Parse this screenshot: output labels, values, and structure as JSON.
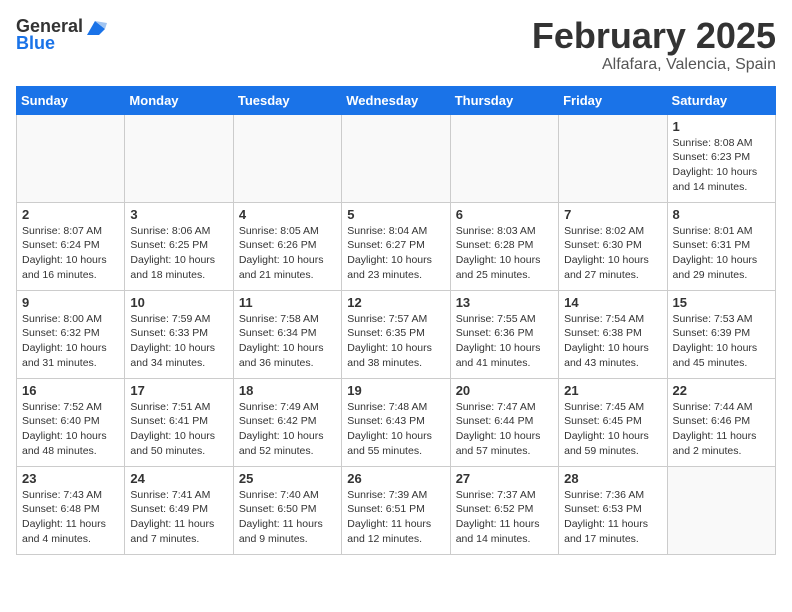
{
  "header": {
    "logo_general": "General",
    "logo_blue": "Blue",
    "month_title": "February 2025",
    "location": "Alfafara, Valencia, Spain"
  },
  "days_of_week": [
    "Sunday",
    "Monday",
    "Tuesday",
    "Wednesday",
    "Thursday",
    "Friday",
    "Saturday"
  ],
  "weeks": [
    [
      {
        "day": "",
        "info": ""
      },
      {
        "day": "",
        "info": ""
      },
      {
        "day": "",
        "info": ""
      },
      {
        "day": "",
        "info": ""
      },
      {
        "day": "",
        "info": ""
      },
      {
        "day": "",
        "info": ""
      },
      {
        "day": "1",
        "info": "Sunrise: 8:08 AM\nSunset: 6:23 PM\nDaylight: 10 hours\nand 14 minutes."
      }
    ],
    [
      {
        "day": "2",
        "info": "Sunrise: 8:07 AM\nSunset: 6:24 PM\nDaylight: 10 hours\nand 16 minutes."
      },
      {
        "day": "3",
        "info": "Sunrise: 8:06 AM\nSunset: 6:25 PM\nDaylight: 10 hours\nand 18 minutes."
      },
      {
        "day": "4",
        "info": "Sunrise: 8:05 AM\nSunset: 6:26 PM\nDaylight: 10 hours\nand 21 minutes."
      },
      {
        "day": "5",
        "info": "Sunrise: 8:04 AM\nSunset: 6:27 PM\nDaylight: 10 hours\nand 23 minutes."
      },
      {
        "day": "6",
        "info": "Sunrise: 8:03 AM\nSunset: 6:28 PM\nDaylight: 10 hours\nand 25 minutes."
      },
      {
        "day": "7",
        "info": "Sunrise: 8:02 AM\nSunset: 6:30 PM\nDaylight: 10 hours\nand 27 minutes."
      },
      {
        "day": "8",
        "info": "Sunrise: 8:01 AM\nSunset: 6:31 PM\nDaylight: 10 hours\nand 29 minutes."
      }
    ],
    [
      {
        "day": "9",
        "info": "Sunrise: 8:00 AM\nSunset: 6:32 PM\nDaylight: 10 hours\nand 31 minutes."
      },
      {
        "day": "10",
        "info": "Sunrise: 7:59 AM\nSunset: 6:33 PM\nDaylight: 10 hours\nand 34 minutes."
      },
      {
        "day": "11",
        "info": "Sunrise: 7:58 AM\nSunset: 6:34 PM\nDaylight: 10 hours\nand 36 minutes."
      },
      {
        "day": "12",
        "info": "Sunrise: 7:57 AM\nSunset: 6:35 PM\nDaylight: 10 hours\nand 38 minutes."
      },
      {
        "day": "13",
        "info": "Sunrise: 7:55 AM\nSunset: 6:36 PM\nDaylight: 10 hours\nand 41 minutes."
      },
      {
        "day": "14",
        "info": "Sunrise: 7:54 AM\nSunset: 6:38 PM\nDaylight: 10 hours\nand 43 minutes."
      },
      {
        "day": "15",
        "info": "Sunrise: 7:53 AM\nSunset: 6:39 PM\nDaylight: 10 hours\nand 45 minutes."
      }
    ],
    [
      {
        "day": "16",
        "info": "Sunrise: 7:52 AM\nSunset: 6:40 PM\nDaylight: 10 hours\nand 48 minutes."
      },
      {
        "day": "17",
        "info": "Sunrise: 7:51 AM\nSunset: 6:41 PM\nDaylight: 10 hours\nand 50 minutes."
      },
      {
        "day": "18",
        "info": "Sunrise: 7:49 AM\nSunset: 6:42 PM\nDaylight: 10 hours\nand 52 minutes."
      },
      {
        "day": "19",
        "info": "Sunrise: 7:48 AM\nSunset: 6:43 PM\nDaylight: 10 hours\nand 55 minutes."
      },
      {
        "day": "20",
        "info": "Sunrise: 7:47 AM\nSunset: 6:44 PM\nDaylight: 10 hours\nand 57 minutes."
      },
      {
        "day": "21",
        "info": "Sunrise: 7:45 AM\nSunset: 6:45 PM\nDaylight: 10 hours\nand 59 minutes."
      },
      {
        "day": "22",
        "info": "Sunrise: 7:44 AM\nSunset: 6:46 PM\nDaylight: 11 hours\nand 2 minutes."
      }
    ],
    [
      {
        "day": "23",
        "info": "Sunrise: 7:43 AM\nSunset: 6:48 PM\nDaylight: 11 hours\nand 4 minutes."
      },
      {
        "day": "24",
        "info": "Sunrise: 7:41 AM\nSunset: 6:49 PM\nDaylight: 11 hours\nand 7 minutes."
      },
      {
        "day": "25",
        "info": "Sunrise: 7:40 AM\nSunset: 6:50 PM\nDaylight: 11 hours\nand 9 minutes."
      },
      {
        "day": "26",
        "info": "Sunrise: 7:39 AM\nSunset: 6:51 PM\nDaylight: 11 hours\nand 12 minutes."
      },
      {
        "day": "27",
        "info": "Sunrise: 7:37 AM\nSunset: 6:52 PM\nDaylight: 11 hours\nand 14 minutes."
      },
      {
        "day": "28",
        "info": "Sunrise: 7:36 AM\nSunset: 6:53 PM\nDaylight: 11 hours\nand 17 minutes."
      },
      {
        "day": "",
        "info": ""
      }
    ]
  ]
}
